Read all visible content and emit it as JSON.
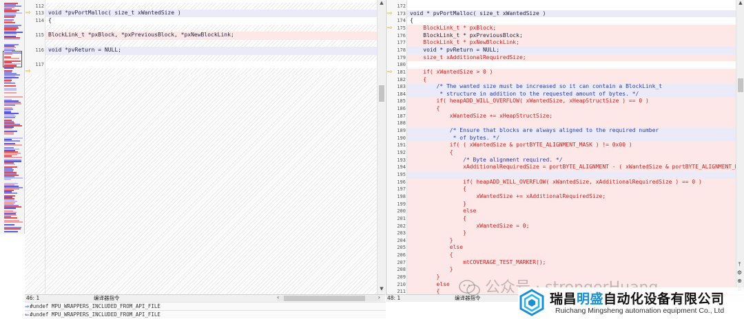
{
  "colors": {
    "diff_bg": "#fde7e7",
    "modified_bg": "#eaeaf8",
    "diff_text": "#d32020",
    "arrow": "#e0a800",
    "brand_blue": "#1a8fd6"
  },
  "left_pane": {
    "lines": [
      {
        "num": "112",
        "text": "",
        "style": "hatch",
        "arrow": false
      },
      {
        "num": "113",
        "text": "void *pvPortMalloc( size_t xWantedSize )",
        "style": "mod",
        "arrow": true,
        "color": "dark"
      },
      {
        "num": "114",
        "text": "{",
        "style": "plain",
        "arrow": false,
        "color": "dark"
      },
      {
        "num": "",
        "text": "",
        "style": "hatch",
        "arrow": false
      },
      {
        "num": "115",
        "text": "BlockLink_t *pxBlock, *pxPreviousBlock, *pxNewBlockLink;",
        "style": "diff",
        "arrow": false,
        "color": "dark"
      },
      {
        "num": "",
        "text": "",
        "style": "hatch",
        "arrow": false
      },
      {
        "num": "116",
        "text": "void *pvReturn = NULL;",
        "style": "mod",
        "arrow": false,
        "color": "dark"
      },
      {
        "num": "",
        "text": "",
        "style": "hatch",
        "arrow": false
      },
      {
        "num": "117",
        "text": "",
        "style": "plain",
        "arrow": false
      },
      {
        "num": "",
        "text": "",
        "style": "hatch",
        "arrow": true
      }
    ],
    "status_position": "46: 1",
    "status_mode": "编译器指令"
  },
  "right_pane": {
    "lines": [
      {
        "num": "172",
        "text": "",
        "style": "plain",
        "arrow": false
      },
      {
        "num": "173",
        "text": "void * pvPortMalloc( size_t xWantedSize )",
        "style": "mod",
        "arrow": true,
        "color": "dark"
      },
      {
        "num": "174",
        "text": "{",
        "style": "plain",
        "arrow": false,
        "color": "dark"
      },
      {
        "num": "175",
        "text": "    BlockLink_t * pxBlock;",
        "style": "diff",
        "arrow": true,
        "color": "red"
      },
      {
        "num": "176",
        "text": "    BlockLink_t * pxPreviousBlock;",
        "style": "diff",
        "arrow": false,
        "color": "dark"
      },
      {
        "num": "177",
        "text": "    BlockLink_t * pxNewBlockLink;",
        "style": "diff",
        "arrow": false,
        "color": "red"
      },
      {
        "num": "178",
        "text": "    void * pvReturn = NULL;",
        "style": "mod",
        "arrow": false,
        "color": "dark"
      },
      {
        "num": "179",
        "text": "    size_t xAdditionalRequiredSize;",
        "style": "diff",
        "arrow": false,
        "color": "red"
      },
      {
        "num": "180",
        "text": "",
        "style": "plain",
        "arrow": false
      },
      {
        "num": "181",
        "text": "    if( xWantedSize > 0 )",
        "style": "diff",
        "arrow": true,
        "color": "red"
      },
      {
        "num": "182",
        "text": "    {",
        "style": "diff",
        "arrow": false,
        "color": "red"
      },
      {
        "num": "183",
        "text": "        /* The wanted size must be increased so it can contain a BlockLink_t",
        "style": "mod",
        "arrow": false,
        "color": "blue"
      },
      {
        "num": "184",
        "text": "         * structure in addition to the requested amount of bytes. */",
        "style": "mod",
        "arrow": false,
        "color": "blue"
      },
      {
        "num": "185",
        "text": "        if( heapADD_WILL_OVERFLOW( xWantedSize, xHeapStructSize ) == 0 )",
        "style": "diff",
        "arrow": false,
        "color": "red"
      },
      {
        "num": "186",
        "text": "        {",
        "style": "diff",
        "arrow": false,
        "color": "red"
      },
      {
        "num": "187",
        "text": "            xWantedSize += xHeapStructSize;",
        "style": "diff",
        "arrow": false,
        "color": "red"
      },
      {
        "num": "188",
        "text": "",
        "style": "diff",
        "arrow": false
      },
      {
        "num": "189",
        "text": "            /* Ensure that blocks are always aligned to the required number",
        "style": "mod",
        "arrow": false,
        "color": "blue"
      },
      {
        "num": "190",
        "text": "             * of bytes. */",
        "style": "mod",
        "arrow": false,
        "color": "blue"
      },
      {
        "num": "191",
        "text": "            if( ( xWantedSize & portBYTE_ALIGNMENT_MASK ) != 0x00 )",
        "style": "diff",
        "arrow": false,
        "color": "red"
      },
      {
        "num": "192",
        "text": "            {",
        "style": "diff",
        "arrow": false,
        "color": "red"
      },
      {
        "num": "193",
        "text": "                /* Byte alignment required. */",
        "style": "diff",
        "arrow": false,
        "color": "blue"
      },
      {
        "num": "194",
        "text": "                xAdditionalRequiredSize = portBYTE_ALIGNMENT - ( xWantedSize & portBYTE_ALIGNMENT_MASK );",
        "style": "diff",
        "arrow": false,
        "color": "red"
      },
      {
        "num": "195",
        "text": "",
        "style": "mod",
        "arrow": false
      },
      {
        "num": "196",
        "text": "                if( heapADD_WILL_OVERFLOW( xWantedSize, xAdditionalRequiredSize ) == 0 )",
        "style": "diff",
        "arrow": false,
        "color": "red"
      },
      {
        "num": "197",
        "text": "                {",
        "style": "diff",
        "arrow": false,
        "color": "red"
      },
      {
        "num": "198",
        "text": "                    xWantedSize += xAdditionalRequiredSize;",
        "style": "diff",
        "arrow": false,
        "color": "red"
      },
      {
        "num": "199",
        "text": "                }",
        "style": "diff",
        "arrow": false,
        "color": "red"
      },
      {
        "num": "200",
        "text": "                else",
        "style": "diff",
        "arrow": false,
        "color": "red"
      },
      {
        "num": "201",
        "text": "                {",
        "style": "diff",
        "arrow": false,
        "color": "red"
      },
      {
        "num": "202",
        "text": "                    xWantedSize = 0;",
        "style": "diff",
        "arrow": false,
        "color": "red"
      },
      {
        "num": "203",
        "text": "                }",
        "style": "diff",
        "arrow": false,
        "color": "red"
      },
      {
        "num": "204",
        "text": "            }",
        "style": "diff",
        "arrow": false,
        "color": "red"
      },
      {
        "num": "205",
        "text": "            else",
        "style": "diff",
        "arrow": false,
        "color": "red"
      },
      {
        "num": "206",
        "text": "            {",
        "style": "diff",
        "arrow": false,
        "color": "red"
      },
      {
        "num": "207",
        "text": "                mtCOVERAGE_TEST_MARKER();",
        "style": "diff",
        "arrow": false,
        "color": "red"
      },
      {
        "num": "208",
        "text": "            }",
        "style": "diff",
        "arrow": false,
        "color": "red"
      },
      {
        "num": "209",
        "text": "        }",
        "style": "diff",
        "arrow": false,
        "color": "red"
      },
      {
        "num": "210",
        "text": "        else",
        "style": "diff",
        "arrow": false,
        "color": "red"
      },
      {
        "num": "211",
        "text": "        {",
        "style": "diff",
        "arrow": false,
        "color": "red"
      }
    ],
    "status_position": "48: 1",
    "status_mode": "编译器指令"
  },
  "bottom": {
    "line1": "#undef MPU_WRAPPERS_INCLUDED_FROM_API_FILE",
    "line2": "#undef MPU_WRAPPERS_INCLUDED_FROM_API_FILE"
  },
  "watermark": {
    "wechat_text": "公众号 · strongerHuang",
    "company_cn_prefix": "瑞昌",
    "company_cn_highlight": "明盛",
    "company_cn_suffix": "自动化设备有限公司",
    "company_en": "Ruichang Mingsheng automation equipment Co., Ltd"
  },
  "icons": {
    "arrow": "arrow-right-icon",
    "side": [
      "pin-icon",
      "settings-icon",
      "zoom-icon",
      "zoom-out-icon"
    ]
  }
}
